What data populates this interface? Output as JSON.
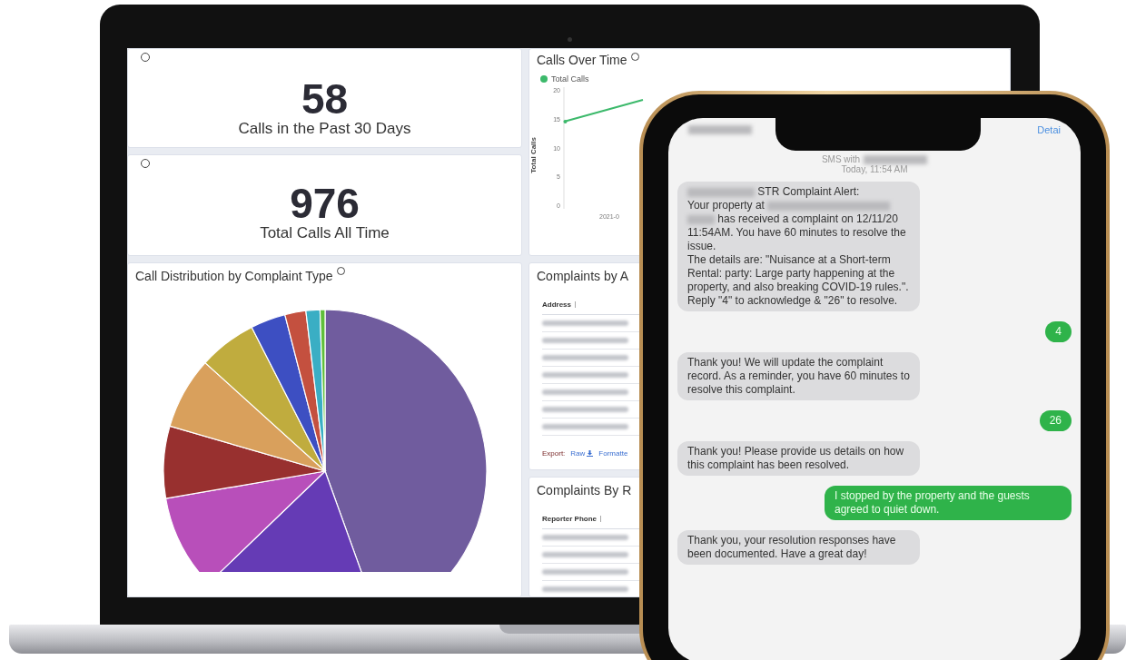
{
  "laptop": {
    "left_cards": [
      {
        "kind": "stat",
        "value": "58",
        "label": "Calls in the Past 30 Days"
      },
      {
        "kind": "stat",
        "value": "976",
        "label": "Total Calls All Time"
      },
      {
        "kind": "pie",
        "title": "Call Distribution by Complaint Type"
      }
    ],
    "right_cards": [
      {
        "kind": "line",
        "title": "Calls Over Time",
        "legend": "Total Calls",
        "ylabel": "Total Calls",
        "yticks": [
          "20",
          "15",
          "10",
          "5",
          "0"
        ],
        "xtick": "2021-0"
      },
      {
        "kind": "table",
        "title": "Complaints by A",
        "column": "Address",
        "rows": [
          {
            "kind": "redacted"
          },
          {
            "kind": "redacted"
          },
          {
            "kind": "redacted"
          },
          {
            "kind": "redacted"
          },
          {
            "kind": "redacted"
          },
          {
            "kind": "redacted"
          },
          {
            "kind": "redacted"
          }
        ],
        "export": {
          "label": "Export:",
          "links": [
            "Raw",
            "Formatte"
          ]
        }
      },
      {
        "kind": "table",
        "title": "Complaints By R",
        "column": "Reporter Phone",
        "rows": [
          {
            "kind": "redacted"
          },
          {
            "kind": "redacted"
          },
          {
            "kind": "redacted"
          },
          {
            "kind": "redacted"
          }
        ]
      }
    ]
  },
  "phone": {
    "action": "Detai",
    "header": {
      "prefix": "SMS with",
      "time": "Today, 11:54 AM"
    },
    "messages": [
      {
        "kind": "received",
        "parts": [
          {
            "kind": "redacted"
          },
          {
            "kind": "text",
            "text": " STR Complaint Alert:\nYour property at "
          },
          {
            "kind": "redacted"
          },
          {
            "kind": "redacted"
          },
          {
            "kind": "text",
            "text": " has received a complaint on 12/11/20 11:54AM. You have 60 minutes to resolve the issue.\nThe details are: \"Nuisance at a Short-term Rental: party: Large party happening at the property, and also breaking COVID-19 rules.\".\nReply \"4\" to acknowledge & \"26\" to resolve."
          }
        ]
      },
      {
        "kind": "sent",
        "parts": [
          {
            "kind": "text",
            "text": "4"
          }
        ]
      },
      {
        "kind": "received",
        "parts": [
          {
            "kind": "text",
            "text": "Thank you! We will update the complaint record. As a reminder, you have 60 minutes to resolve this complaint."
          }
        ]
      },
      {
        "kind": "sent",
        "parts": [
          {
            "kind": "text",
            "text": "26"
          }
        ]
      },
      {
        "kind": "received",
        "parts": [
          {
            "kind": "text",
            "text": "Thank you! Please provide us details on how this complaint has been resolved."
          }
        ]
      },
      {
        "kind": "sent",
        "parts": [
          {
            "kind": "text",
            "text": "I stopped by the property and the guests agreed to quiet down."
          }
        ]
      },
      {
        "kind": "received",
        "parts": [
          {
            "kind": "text",
            "text": "Thank you, your resolution responses have been documented. Have a great day!"
          }
        ]
      }
    ]
  }
}
